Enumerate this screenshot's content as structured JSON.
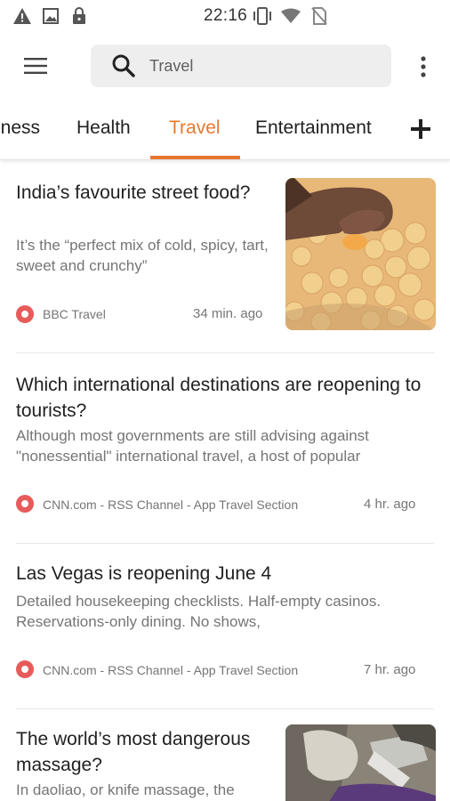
{
  "status_bar": {
    "time": "22:16"
  },
  "search": {
    "value": "Travel",
    "placeholder": "Travel"
  },
  "tabs": [
    {
      "label": "iness"
    },
    {
      "label": "Health"
    },
    {
      "label": "Travel",
      "active": true
    },
    {
      "label": "Entertainment"
    }
  ],
  "colors": {
    "accent": "#e8772e",
    "source_logo": "#e75b5b"
  },
  "articles": [
    {
      "title": "India’s favourite street food?",
      "snippet": "It’s the “perfect mix of cold, spicy, tart, sweet and crunchy”",
      "source": "BBC Travel",
      "time": "34 min. ago",
      "has_image": true
    },
    {
      "title": "Which international destinations are reopening to tourists?",
      "snippet": "Although most governments are still advising against \"nonessential\" international travel, a host of popular",
      "source": "CNN.com - RSS Channel - App Travel Section",
      "time": "4 hr. ago",
      "has_image": false
    },
    {
      "title": "Las Vegas is reopening June 4",
      "snippet": "Detailed housekeeping checklists. Half-empty casinos. Reservations-only dining. No shows,",
      "source": "CNN.com - RSS Channel - App Travel Section",
      "time": "7 hr. ago",
      "has_image": false
    },
    {
      "title": "The world’s most dangerous massage?",
      "snippet": "In daoliao, or knife massage, the",
      "has_image": true
    }
  ]
}
